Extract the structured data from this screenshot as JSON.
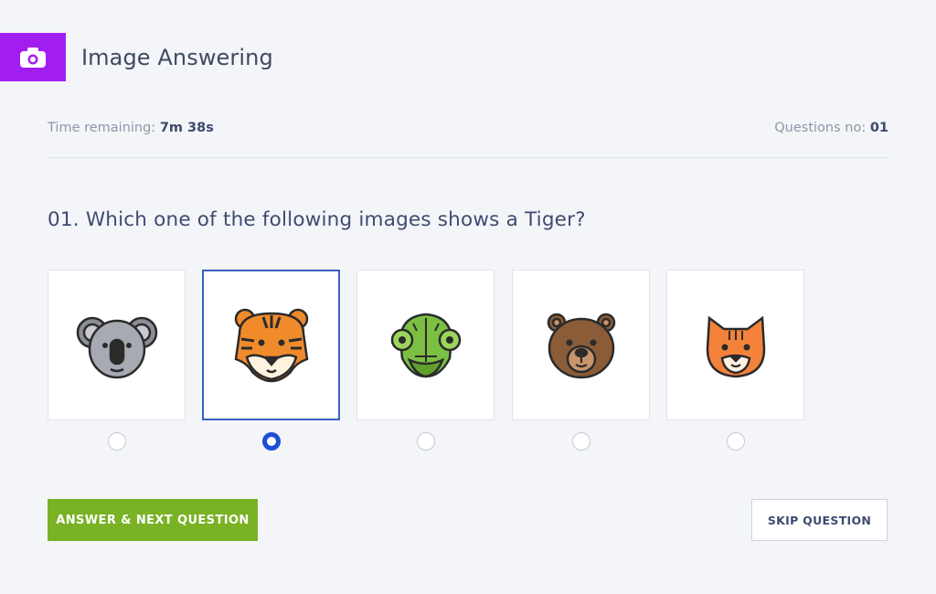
{
  "header": {
    "title": "Image Answering",
    "icon": "camera-icon",
    "accent": "#a21ef0"
  },
  "meta": {
    "time_label": "Time remaining:",
    "time_value": "7m 38s",
    "question_label": "Questions no:",
    "question_value": "01"
  },
  "question": {
    "text": "01. Which one of the following images shows a Tiger?"
  },
  "options": [
    {
      "animal": "koala-icon",
      "selected": false
    },
    {
      "animal": "tiger-icon",
      "selected": true
    },
    {
      "animal": "chameleon-icon",
      "selected": false
    },
    {
      "animal": "bear-icon",
      "selected": false
    },
    {
      "animal": "cat-icon",
      "selected": false
    }
  ],
  "actions": {
    "primary_label": "ANSWER & NEXT QUESTION",
    "secondary_label": "SKIP QUESTION",
    "primary_color": "#79b224",
    "selected_color": "#1e4fd6"
  }
}
